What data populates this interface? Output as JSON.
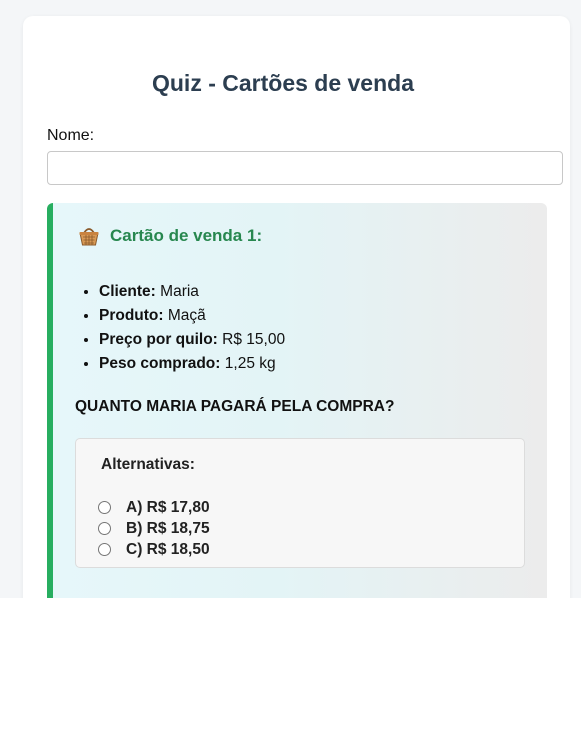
{
  "quiz": {
    "title": "Quiz - Cartões de venda",
    "name_label": "Nome:",
    "name_value": "",
    "name_placeholder": ""
  },
  "card": {
    "icon": "basket-icon",
    "title": "Cartão de venda 1:",
    "details": [
      {
        "label": "Cliente:",
        "value": "Maria"
      },
      {
        "label": "Produto:",
        "value": "Maçã"
      },
      {
        "label": "Preço por quilo:",
        "value": "R$ 15,00"
      },
      {
        "label": "Peso comprado:",
        "value": "1,25 kg"
      }
    ],
    "question": "QUANTO MARIA PAGARÁ PELA COMPRA?",
    "alternatives_title": "Alternativas:",
    "alternatives": [
      {
        "label": "A) R$ 17,80",
        "selected": false
      },
      {
        "label": "B) R$ 18,75",
        "selected": false
      },
      {
        "label": "C) R$ 18,50",
        "selected": false
      }
    ]
  },
  "colors": {
    "title": "#2c3e50",
    "accent": "#27ae60",
    "card_title": "#27874f"
  }
}
